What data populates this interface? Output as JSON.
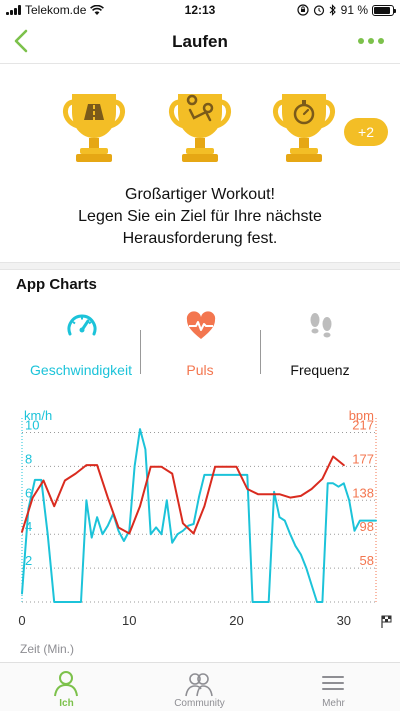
{
  "status": {
    "carrier": "Telekom.de",
    "time": "12:13",
    "battery_text": "91 %",
    "battery_level": 0.91
  },
  "nav": {
    "title": "Laufen",
    "accent": "#7cc14b",
    "back_icon": "chevron-left-icon",
    "more_icon": "more-dots-icon"
  },
  "trophies": {
    "items": [
      "road-trophy",
      "route-trophy",
      "stopwatch-trophy"
    ],
    "more_badge": "+2",
    "color": "#f3be26"
  },
  "workout": {
    "headline": "Großartiger Workout!",
    "message_line1": "Legen Sie ein Ziel für Ihre nächste",
    "message_line2": "Herausforderung fest."
  },
  "app_charts": {
    "title": "App Charts",
    "tabs": [
      {
        "label": "Geschwindigkeit",
        "icon": "speedometer-icon",
        "color": "#1cc3d9"
      },
      {
        "label": "Puls",
        "icon": "heart-pulse-icon",
        "color": "#f3764f"
      },
      {
        "label": "Frequenz",
        "icon": "footsteps-icon",
        "color": "#111111"
      }
    ]
  },
  "chart_data": {
    "type": "line",
    "xlabel": "Zeit (Min.)",
    "x_ticks": [
      "0",
      "10",
      "20",
      "30"
    ],
    "xlim": [
      0,
      33
    ],
    "y_left": {
      "label": "km/h",
      "ticks": [
        "2",
        "4",
        "6",
        "8",
        "10"
      ],
      "lim": [
        0,
        10.5
      ],
      "color": "#1cc3d9"
    },
    "y_right": {
      "label": "bpm",
      "ticks": [
        "58",
        "98",
        "138",
        "177",
        "217"
      ],
      "lim": [
        18,
        226
      ],
      "color": "#f3764f"
    },
    "grid": "y-dotted",
    "end_marker": "finish-flag-icon",
    "series": [
      {
        "name": "Geschwindigkeit",
        "color": "#1cc3d9",
        "axis": "left",
        "x": [
          0,
          0.6,
          1.2,
          1.8,
          2.4,
          3,
          3.5,
          4,
          4.5,
          5,
          5.5,
          6,
          6.5,
          7,
          7.5,
          8,
          8.5,
          9,
          9.5,
          10,
          10.5,
          11,
          11.5,
          12,
          12.5,
          13,
          13.5,
          14,
          14.5,
          15,
          15.5,
          16,
          16.5,
          17,
          17.5,
          18,
          18.5,
          19,
          19.5,
          20,
          20.5,
          21,
          21.5,
          22,
          22.5,
          23,
          23.5,
          24,
          24.5,
          25,
          25.5,
          26,
          26.5,
          27,
          27.5,
          28,
          28.5,
          29,
          29.5,
          30,
          30.5,
          31,
          31.5,
          32,
          33
        ],
        "y": [
          0.5,
          5.5,
          7.2,
          7.2,
          4.0,
          0.0,
          0.0,
          0.0,
          0.0,
          0.0,
          0.0,
          6.0,
          3.8,
          5.0,
          4.0,
          4.5,
          5.2,
          4.2,
          3.6,
          4.2,
          8.0,
          10.2,
          9.0,
          4.0,
          4.4,
          4.0,
          6.0,
          3.5,
          4.0,
          4.2,
          4.5,
          4.6,
          6.2,
          7.5,
          7.5,
          7.5,
          7.5,
          7.5,
          7.5,
          7.5,
          7.5,
          7.5,
          0.0,
          0.0,
          0.0,
          0.0,
          6.5,
          5.0,
          4.8,
          4.0,
          3.3,
          2.8,
          2.0,
          1.0,
          0.0,
          0.0,
          7.0,
          7.0,
          6.8,
          7.0,
          6.0,
          4.2,
          4.8,
          4.8,
          4.8
        ]
      },
      {
        "name": "Puls",
        "color": "#d92b1f",
        "axis": "right",
        "x": [
          0,
          1,
          2,
          3,
          4,
          5,
          6,
          7,
          8,
          9,
          10,
          11,
          12,
          13,
          14,
          15,
          16,
          17,
          18,
          19,
          20,
          21,
          22,
          23,
          24,
          25,
          26,
          27,
          28,
          29,
          30
        ],
        "y": [
          100,
          140,
          160,
          130,
          160,
          168,
          178,
          178,
          140,
          105,
          98,
          130,
          176,
          176,
          168,
          110,
          98,
          130,
          176,
          176,
          176,
          150,
          144,
          144,
          144,
          140,
          142,
          150,
          162,
          188,
          178
        ]
      }
    ]
  },
  "tab_bar": {
    "items": [
      {
        "label": "Ich",
        "icon": "person-icon",
        "active": true
      },
      {
        "label": "Community",
        "icon": "community-icon",
        "active": false
      },
      {
        "label": "Mehr",
        "icon": "menu-icon",
        "active": false
      }
    ]
  }
}
